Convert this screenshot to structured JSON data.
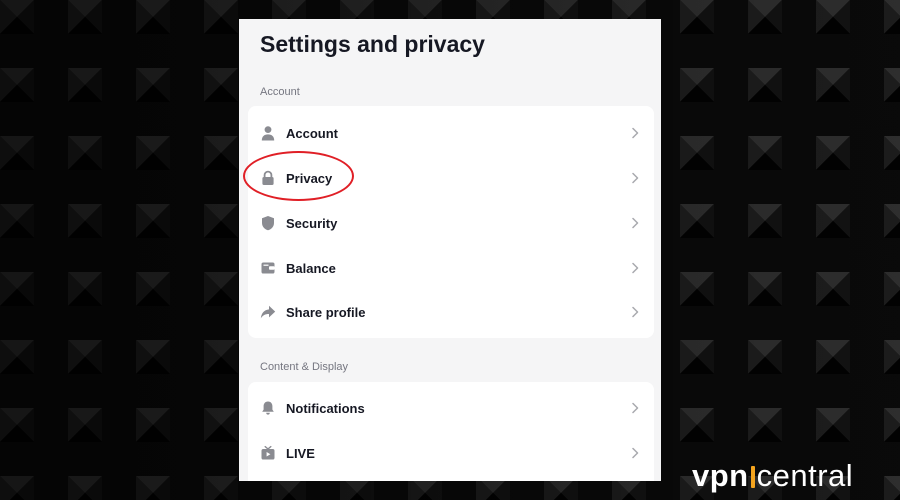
{
  "page": {
    "title": "Settings and privacy"
  },
  "sections": [
    {
      "label": "Account",
      "items": [
        {
          "label": "Account",
          "icon": "person-icon"
        },
        {
          "label": "Privacy",
          "icon": "lock-icon"
        },
        {
          "label": "Security",
          "icon": "shield-icon"
        },
        {
          "label": "Balance",
          "icon": "wallet-icon"
        },
        {
          "label": "Share profile",
          "icon": "share-arrow-icon"
        }
      ]
    },
    {
      "label": "Content & Display",
      "items": [
        {
          "label": "Notifications",
          "icon": "bell-icon"
        },
        {
          "label": "LIVE",
          "icon": "live-tv-icon"
        }
      ]
    }
  ],
  "annotation": {
    "color": "#e01f26"
  },
  "brand": {
    "part1": "vpn",
    "part2": "central",
    "accent": "#f4a41e"
  },
  "colors": {
    "panel_bg": "#f5f5f6",
    "card_bg": "#ffffff",
    "text": "#161823",
    "icon": "#8a8b91"
  }
}
